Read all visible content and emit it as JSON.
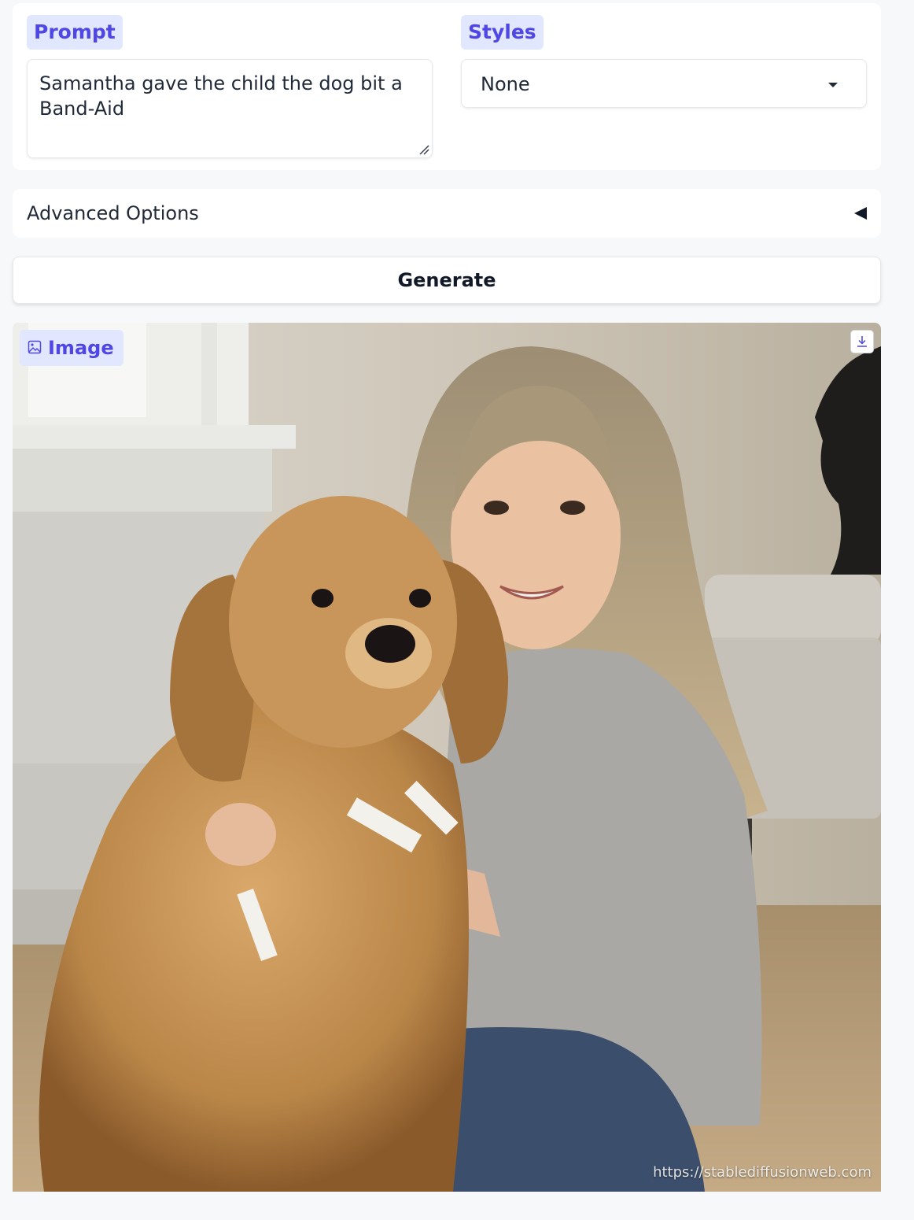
{
  "prompt": {
    "label": "Prompt",
    "value": "Samantha gave the child the dog bit a Band-Aid"
  },
  "styles": {
    "label": "Styles",
    "selected": "None"
  },
  "advanced_options": {
    "label": "Advanced Options"
  },
  "generate": {
    "label": "Generate"
  },
  "output_image": {
    "label": "Image",
    "description": "Generated photo of a smiling girl with long light-brown hair in a grey t-shirt and jeans, hugging a golden cocker spaniel with white band-aid strips, sitting on a carpet beside a window and a grey sofa",
    "watermark": "https://stablediffusionweb.com"
  },
  "icons": {
    "image": "image-icon",
    "download": "download-icon",
    "dropdown": "chevron-down-icon",
    "collapse": "triangle-left-icon",
    "resize": "resize-grip-icon"
  },
  "colors": {
    "accent": "#4f46e5",
    "accent_bg": "#e0e7ff",
    "page_bg": "#f7f8fa",
    "panel_bg": "#ffffff"
  }
}
